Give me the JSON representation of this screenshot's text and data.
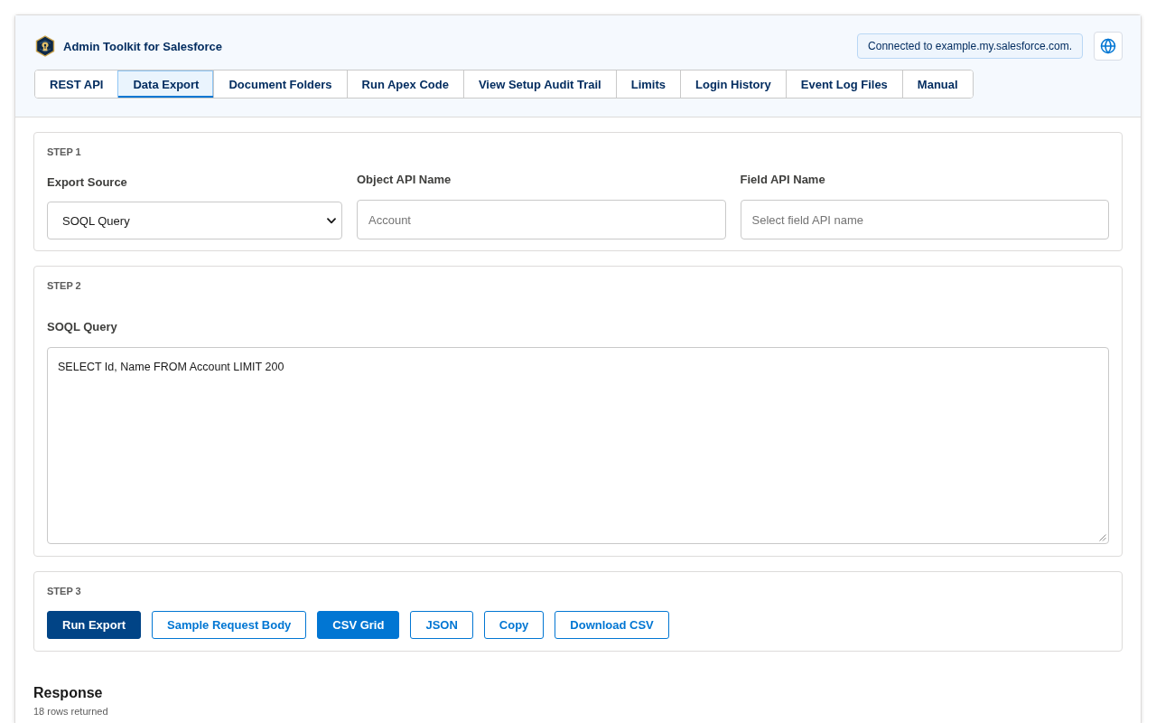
{
  "header": {
    "title": "Admin Toolkit for Salesforce",
    "connection": "Connected to example.my.salesforce.com."
  },
  "tabs": [
    {
      "label": "REST API",
      "selected": false
    },
    {
      "label": "Data Export",
      "selected": true
    },
    {
      "label": "Document Folders",
      "selected": false
    },
    {
      "label": "Run Apex Code",
      "selected": false
    },
    {
      "label": "View Setup Audit Trail",
      "selected": false
    },
    {
      "label": "Limits",
      "selected": false
    },
    {
      "label": "Login History",
      "selected": false
    },
    {
      "label": "Event Log Files",
      "selected": false
    },
    {
      "label": "Manual",
      "selected": false
    }
  ],
  "step1": {
    "label": "STEP 1",
    "export_source": {
      "label": "Export Source",
      "value": "SOQL Query"
    },
    "object_api_name": {
      "label": "Object API Name",
      "placeholder": "Account"
    },
    "field_api_name": {
      "label": "Field API Name",
      "placeholder": "Select field API name"
    }
  },
  "step2": {
    "label": "STEP 2",
    "soql_query": {
      "label": "SOQL Query",
      "value": "SELECT Id, Name FROM Account LIMIT 200"
    }
  },
  "step3": {
    "label": "STEP 3",
    "buttons": [
      {
        "label": "Run Export",
        "kind": "primary"
      },
      {
        "label": "Sample Request Body",
        "kind": "outline"
      }
    ],
    "view_modes": [
      {
        "label": "CSV Grid",
        "selected": true
      },
      {
        "label": "JSON",
        "selected": false
      }
    ],
    "tools": [
      {
        "label": "Copy",
        "kind": "outline"
      },
      {
        "label": "Download CSV",
        "kind": "outline"
      }
    ]
  },
  "response": {
    "title": "Response",
    "summary": "18 rows returned"
  }
}
